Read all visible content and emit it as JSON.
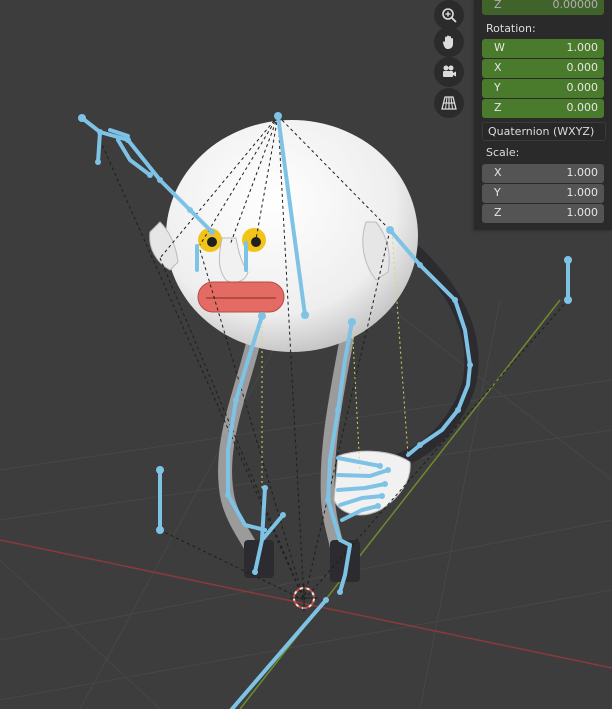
{
  "panel": {
    "location_z": {
      "label": "Z",
      "value": "0.00000"
    },
    "rotation": {
      "title": "Rotation:",
      "fields": [
        {
          "label": "W",
          "value": "1.000"
        },
        {
          "label": "X",
          "value": "0.000"
        },
        {
          "label": "Y",
          "value": "0.000"
        },
        {
          "label": "Z",
          "value": "0.000"
        }
      ]
    },
    "rotation_mode": "Quaternion (WXYZ)",
    "scale": {
      "title": "Scale:",
      "fields": [
        {
          "label": "X",
          "value": "1.000"
        },
        {
          "label": "Y",
          "value": "1.000"
        },
        {
          "label": "Z",
          "value": "1.000"
        }
      ]
    }
  },
  "nav_icons": [
    "zoom-icon",
    "hand-pan-icon",
    "camera-icon",
    "perspective-grid-icon"
  ],
  "colors": {
    "viewport_bg": "#3d3d3d",
    "bone_selected": "#7ec3e6",
    "field_green": "#4a7b2c",
    "axis_red": "#8a3a3a",
    "axis_green": "#6f8a2f"
  }
}
